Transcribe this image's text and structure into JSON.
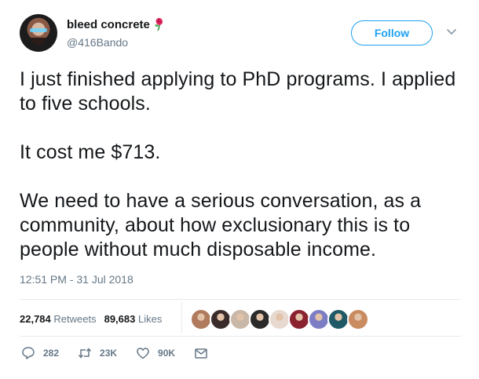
{
  "user": {
    "display_name": "bleed concrete",
    "handle": "@416Bando",
    "follow_label": "Follow"
  },
  "tweet": {
    "paragraphs": [
      "I just finished applying to PhD programs. I applied to five schools.",
      "It cost me $713.",
      "We need to have a serious conversation, as a community, about how exclusionary this is to people without much disposable income."
    ],
    "timestamp": "12:51 PM - 31 Jul 2018"
  },
  "stats": {
    "retweets_count": "22,784",
    "retweets_label": "Retweets",
    "likes_count": "89,683",
    "likes_label": "Likes"
  },
  "liker_avatar_colors": [
    "#b07a5e",
    "#3a2c2a",
    "#c9b7a8",
    "#2b2b2b",
    "#e7d9d0",
    "#8a2230",
    "#7d7dc5",
    "#1f5a66",
    "#c98b5f"
  ],
  "actions": {
    "reply_count": "282",
    "retweet_count": "23K",
    "like_count": "90K"
  },
  "colors": {
    "accent": "#1da1f2",
    "secondary_text": "#657786",
    "primary_text": "#14171a"
  }
}
